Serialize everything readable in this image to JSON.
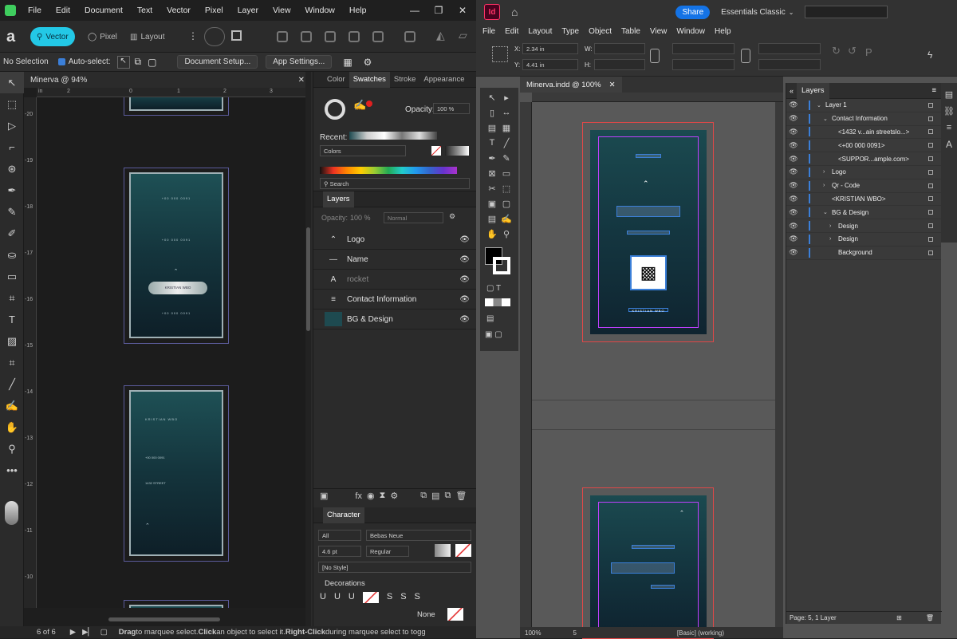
{
  "affinity": {
    "menu": [
      "File",
      "Edit",
      "Document",
      "Text",
      "Vector",
      "Pixel",
      "Layer",
      "View",
      "Window",
      "Help"
    ],
    "personas": {
      "vector": "Vector",
      "pixel": "Pixel",
      "layout": "Layout"
    },
    "context": {
      "selection": "No Selection",
      "auto_select": "Auto-select:",
      "doc_setup": "Document Setup...",
      "app_settings": "App Settings..."
    },
    "doc_tab": "Minerva @ 94%",
    "ruler_h": [
      "2",
      "0",
      "1",
      "2",
      "3"
    ],
    "ruler_v": [
      "-20",
      "-19",
      "-18",
      "-17",
      "-16",
      "-15",
      "-14",
      "-13",
      "-12",
      "-11",
      "-10"
    ],
    "card1": {
      "name": "KRISTIAN WBO",
      "line1": "+00 000 0091"
    },
    "card2": {
      "name": "KRISTIAN WBO",
      "line1": "+00 000 0091",
      "line2": "1432 STREET"
    },
    "swatch_tabs": [
      "Color",
      "Swatches",
      "Stroke",
      "Appearance"
    ],
    "opacity_label": "Opacity:",
    "opacity_value": "100 %",
    "recent_label": "Recent:",
    "palette": "Colors",
    "search_placeholder": "Search",
    "layers_tab": "Layers",
    "layers_opacity_label": "Opacity:",
    "layers_opacity": "100 %",
    "blend": "Normal",
    "layers": [
      {
        "name": "Logo",
        "thumb": "logo-icon"
      },
      {
        "name": "Name",
        "thumb": "name-thumb"
      },
      {
        "name": "rocket",
        "thumb": "text-thumb"
      },
      {
        "name": "Contact Information",
        "thumb": "contact-thumb"
      },
      {
        "name": "BG & Design",
        "thumb": "bg-thumb"
      }
    ],
    "character_tab": "Character",
    "char_scope": "All",
    "font": "Bebas Neue",
    "size": "4.6 pt",
    "weight": "Regular",
    "style": "[No Style]",
    "decorations": "Decorations",
    "none_label": "None",
    "status": {
      "page": "6 of 6",
      "hint_bold1": "Drag",
      "hint1": " to marquee select. ",
      "hint_bold2": "Click",
      "hint2": " an object to select it. ",
      "hint_bold3": "Right-Click",
      "hint3": " during marquee select to togg"
    }
  },
  "indesign": {
    "app_icon": "Id",
    "share": "Share",
    "workspace": "Essentials Classic",
    "menu": [
      "File",
      "Edit",
      "Layout",
      "Type",
      "Object",
      "Table",
      "View",
      "Window",
      "Help"
    ],
    "x": "2.34 in",
    "y": "4.41 in",
    "labels": {
      "x": "X:",
      "y": "Y:",
      "w": "W:",
      "h": "H:"
    },
    "doc_tab": "Minerva.indd @ 100%",
    "layers_title": "Layers",
    "layers": [
      {
        "name": "Layer 1",
        "indent": 0,
        "expanded": true
      },
      {
        "name": "Contact Information",
        "indent": 1,
        "expanded": true
      },
      {
        "name": "<1432 v...ain streetslo...>",
        "indent": 2,
        "expanded": false
      },
      {
        "name": "<+00 000 0091>",
        "indent": 2,
        "expanded": false
      },
      {
        "name": "<SUPPOR...ample.com>",
        "indent": 2,
        "expanded": false
      },
      {
        "name": "Logo",
        "indent": 1,
        "expanded": false
      },
      {
        "name": "Qr - Code",
        "indent": 1,
        "expanded": false
      },
      {
        "name": "<KRISTIAN WBO>",
        "indent": 1,
        "expanded": false
      },
      {
        "name": "BG & Design",
        "indent": 1,
        "expanded": true
      },
      {
        "name": "Design",
        "indent": 2,
        "expanded": false
      },
      {
        "name": "Design",
        "indent": 2,
        "expanded": false
      },
      {
        "name": "Background",
        "indent": 2,
        "expanded": false
      }
    ],
    "layers_footer": "Page: 5, 1 Layer",
    "status": {
      "zoom": "100%",
      "page": "5",
      "style": "[Basic] (working)"
    },
    "qr_name": "KRISTIAN WBO"
  }
}
